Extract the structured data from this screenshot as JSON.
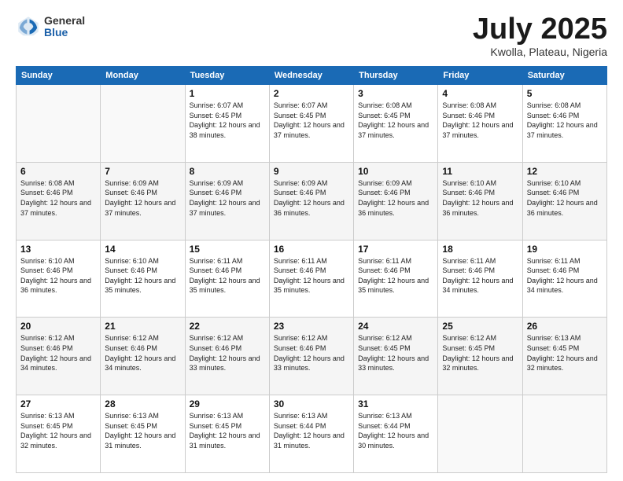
{
  "logo": {
    "general": "General",
    "blue": "Blue"
  },
  "header": {
    "title": "July 2025",
    "subtitle": "Kwolla, Plateau, Nigeria"
  },
  "weekdays": [
    "Sunday",
    "Monday",
    "Tuesday",
    "Wednesday",
    "Thursday",
    "Friday",
    "Saturday"
  ],
  "weeks": [
    [
      {
        "day": "",
        "sunrise": "",
        "sunset": "",
        "daylight": ""
      },
      {
        "day": "",
        "sunrise": "",
        "sunset": "",
        "daylight": ""
      },
      {
        "day": "1",
        "sunrise": "Sunrise: 6:07 AM",
        "sunset": "Sunset: 6:45 PM",
        "daylight": "Daylight: 12 hours and 38 minutes."
      },
      {
        "day": "2",
        "sunrise": "Sunrise: 6:07 AM",
        "sunset": "Sunset: 6:45 PM",
        "daylight": "Daylight: 12 hours and 37 minutes."
      },
      {
        "day": "3",
        "sunrise": "Sunrise: 6:08 AM",
        "sunset": "Sunset: 6:45 PM",
        "daylight": "Daylight: 12 hours and 37 minutes."
      },
      {
        "day": "4",
        "sunrise": "Sunrise: 6:08 AM",
        "sunset": "Sunset: 6:46 PM",
        "daylight": "Daylight: 12 hours and 37 minutes."
      },
      {
        "day": "5",
        "sunrise": "Sunrise: 6:08 AM",
        "sunset": "Sunset: 6:46 PM",
        "daylight": "Daylight: 12 hours and 37 minutes."
      }
    ],
    [
      {
        "day": "6",
        "sunrise": "Sunrise: 6:08 AM",
        "sunset": "Sunset: 6:46 PM",
        "daylight": "Daylight: 12 hours and 37 minutes."
      },
      {
        "day": "7",
        "sunrise": "Sunrise: 6:09 AM",
        "sunset": "Sunset: 6:46 PM",
        "daylight": "Daylight: 12 hours and 37 minutes."
      },
      {
        "day": "8",
        "sunrise": "Sunrise: 6:09 AM",
        "sunset": "Sunset: 6:46 PM",
        "daylight": "Daylight: 12 hours and 37 minutes."
      },
      {
        "day": "9",
        "sunrise": "Sunrise: 6:09 AM",
        "sunset": "Sunset: 6:46 PM",
        "daylight": "Daylight: 12 hours and 36 minutes."
      },
      {
        "day": "10",
        "sunrise": "Sunrise: 6:09 AM",
        "sunset": "Sunset: 6:46 PM",
        "daylight": "Daylight: 12 hours and 36 minutes."
      },
      {
        "day": "11",
        "sunrise": "Sunrise: 6:10 AM",
        "sunset": "Sunset: 6:46 PM",
        "daylight": "Daylight: 12 hours and 36 minutes."
      },
      {
        "day": "12",
        "sunrise": "Sunrise: 6:10 AM",
        "sunset": "Sunset: 6:46 PM",
        "daylight": "Daylight: 12 hours and 36 minutes."
      }
    ],
    [
      {
        "day": "13",
        "sunrise": "Sunrise: 6:10 AM",
        "sunset": "Sunset: 6:46 PM",
        "daylight": "Daylight: 12 hours and 36 minutes."
      },
      {
        "day": "14",
        "sunrise": "Sunrise: 6:10 AM",
        "sunset": "Sunset: 6:46 PM",
        "daylight": "Daylight: 12 hours and 35 minutes."
      },
      {
        "day": "15",
        "sunrise": "Sunrise: 6:11 AM",
        "sunset": "Sunset: 6:46 PM",
        "daylight": "Daylight: 12 hours and 35 minutes."
      },
      {
        "day": "16",
        "sunrise": "Sunrise: 6:11 AM",
        "sunset": "Sunset: 6:46 PM",
        "daylight": "Daylight: 12 hours and 35 minutes."
      },
      {
        "day": "17",
        "sunrise": "Sunrise: 6:11 AM",
        "sunset": "Sunset: 6:46 PM",
        "daylight": "Daylight: 12 hours and 35 minutes."
      },
      {
        "day": "18",
        "sunrise": "Sunrise: 6:11 AM",
        "sunset": "Sunset: 6:46 PM",
        "daylight": "Daylight: 12 hours and 34 minutes."
      },
      {
        "day": "19",
        "sunrise": "Sunrise: 6:11 AM",
        "sunset": "Sunset: 6:46 PM",
        "daylight": "Daylight: 12 hours and 34 minutes."
      }
    ],
    [
      {
        "day": "20",
        "sunrise": "Sunrise: 6:12 AM",
        "sunset": "Sunset: 6:46 PM",
        "daylight": "Daylight: 12 hours and 34 minutes."
      },
      {
        "day": "21",
        "sunrise": "Sunrise: 6:12 AM",
        "sunset": "Sunset: 6:46 PM",
        "daylight": "Daylight: 12 hours and 34 minutes."
      },
      {
        "day": "22",
        "sunrise": "Sunrise: 6:12 AM",
        "sunset": "Sunset: 6:46 PM",
        "daylight": "Daylight: 12 hours and 33 minutes."
      },
      {
        "day": "23",
        "sunrise": "Sunrise: 6:12 AM",
        "sunset": "Sunset: 6:46 PM",
        "daylight": "Daylight: 12 hours and 33 minutes."
      },
      {
        "day": "24",
        "sunrise": "Sunrise: 6:12 AM",
        "sunset": "Sunset: 6:45 PM",
        "daylight": "Daylight: 12 hours and 33 minutes."
      },
      {
        "day": "25",
        "sunrise": "Sunrise: 6:12 AM",
        "sunset": "Sunset: 6:45 PM",
        "daylight": "Daylight: 12 hours and 32 minutes."
      },
      {
        "day": "26",
        "sunrise": "Sunrise: 6:13 AM",
        "sunset": "Sunset: 6:45 PM",
        "daylight": "Daylight: 12 hours and 32 minutes."
      }
    ],
    [
      {
        "day": "27",
        "sunrise": "Sunrise: 6:13 AM",
        "sunset": "Sunset: 6:45 PM",
        "daylight": "Daylight: 12 hours and 32 minutes."
      },
      {
        "day": "28",
        "sunrise": "Sunrise: 6:13 AM",
        "sunset": "Sunset: 6:45 PM",
        "daylight": "Daylight: 12 hours and 31 minutes."
      },
      {
        "day": "29",
        "sunrise": "Sunrise: 6:13 AM",
        "sunset": "Sunset: 6:45 PM",
        "daylight": "Daylight: 12 hours and 31 minutes."
      },
      {
        "day": "30",
        "sunrise": "Sunrise: 6:13 AM",
        "sunset": "Sunset: 6:44 PM",
        "daylight": "Daylight: 12 hours and 31 minutes."
      },
      {
        "day": "31",
        "sunrise": "Sunrise: 6:13 AM",
        "sunset": "Sunset: 6:44 PM",
        "daylight": "Daylight: 12 hours and 30 minutes."
      },
      {
        "day": "",
        "sunrise": "",
        "sunset": "",
        "daylight": ""
      },
      {
        "day": "",
        "sunrise": "",
        "sunset": "",
        "daylight": ""
      }
    ]
  ]
}
